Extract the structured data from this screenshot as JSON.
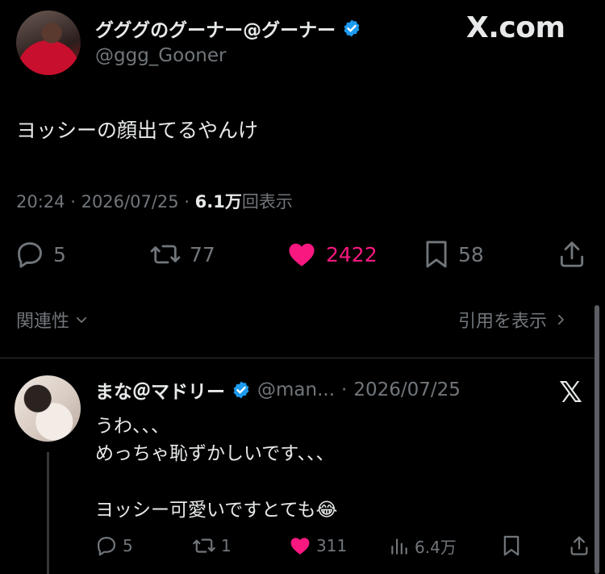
{
  "tweet": {
    "display_name": "グググのグーナー@グーナー",
    "handle": "@ggg_Gooner",
    "site_label": "X.com",
    "text": "ヨッシーの顔出てるやんけ",
    "time": "20:24",
    "date": "2026/07/25",
    "views_count": "6.1万",
    "views_label": "回表示",
    "replies": "5",
    "reposts": "77",
    "likes": "2422",
    "bookmarks": "58",
    "accent_color": "#1d9bf0",
    "like_color": "#f91880"
  },
  "controls": {
    "relevance_label": "関連性",
    "quotes_label": "引用を表示"
  },
  "reply": {
    "display_name": "まな＠マドリー",
    "handle": "@man...",
    "date": "2026/07/25",
    "line1": "うわ、、、",
    "line2": "めっちゃ恥ずかしいです、、、",
    "line3": "ヨッシー可愛いですとても😂",
    "replies": "5",
    "reposts": "1",
    "likes": "311",
    "views": "6.4万"
  },
  "icons": [
    "verified-badge-icon",
    "reply-icon",
    "repost-icon",
    "heart-icon",
    "bookmark-icon",
    "share-icon",
    "chevron-down-icon",
    "chevron-right-icon",
    "x-logo-icon",
    "views-icon"
  ]
}
